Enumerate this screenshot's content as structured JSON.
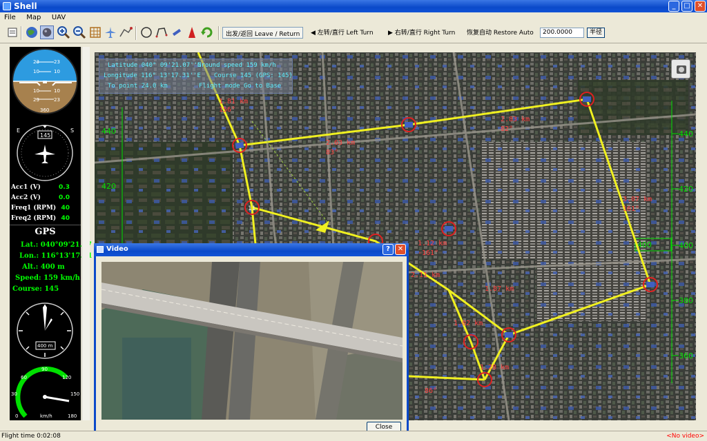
{
  "window": {
    "title": "Shell"
  },
  "menu": [
    "File",
    "Map",
    "UAV"
  ],
  "toolbar": {
    "leave_return": "出发/返回 Leave / Return",
    "left_turn": "◀ 左转/直行 Left Turn",
    "right_turn": "▶ 右转/直行 Right Turn",
    "restore_auto": "恢复自动 Restore Auto",
    "radius_value": "200.0000",
    "radius_button": "半径"
  },
  "instruments": {
    "attitude_ticks": [
      "23",
      "10",
      "10",
      "23"
    ],
    "attitude_heading": "360",
    "compass_heading": "145",
    "compass_letters": [
      "E",
      "S"
    ],
    "acc1_label": "Acc1 (V)",
    "acc1_value": "0.3",
    "acc2_label": "Acc2 (V)",
    "acc2_value": "0.0",
    "freq1_label": "Freq1 (RPM)",
    "freq1_value": "40",
    "freq2_label": "Freq2 (RPM)",
    "freq2_value": "40",
    "altimeter_label": "400 m",
    "speed_ticks": [
      "60",
      "90",
      "120",
      "150",
      "180",
      "30",
      "0"
    ],
    "speed_unit": "km/h"
  },
  "gps": {
    "title": "GPS",
    "lat": "Lat.: 040°09'21.07",
    "lon": "Lon.: 116°13'17.31",
    "alt": "Alt.: 400 m",
    "speed": "Speed: 159 km/h",
    "course": "Course: 145"
  },
  "flight_info": {
    "latitude": "Latitude 040° 09'21.07''N",
    "ground_speed": "Ground speed 159 km/h",
    "longitude": "Longitude 116° 13'17.31''E",
    "course": "Course 145 (GPS: 145)",
    "to_point": "To point 24.0 km",
    "flight_mode": "Flight mode Go to Base"
  },
  "route": {
    "segments": [
      {
        "dist": "1.81 km",
        "bearing": "156°"
      },
      {
        "dist": "2.63 km",
        "bearing": "83°"
      },
      {
        "dist": "2.83 km",
        "bearing": "82°"
      },
      {
        "dist": "3.07 km",
        "bearing": "161°"
      },
      {
        "dist": "1.12 km",
        "bearing": "-161°"
      },
      {
        "dist": "2.11 km",
        "bearing": ""
      },
      {
        "dist": "1.87 km",
        "bearing": ""
      },
      {
        "dist": "1.02 km",
        "bearing": ""
      },
      {
        "dist": "1.28 km",
        "bearing": ""
      },
      {
        "dist": "",
        "bearing": "86°"
      }
    ],
    "waypoint_id": "11"
  },
  "altitude_scale": {
    "left": [
      "440",
      "420"
    ],
    "right": [
      "440",
      "420",
      "400",
      "380",
      "360"
    ],
    "current": "400"
  },
  "video": {
    "title": "Video",
    "help_label": "?",
    "close_label": "Close"
  },
  "status": {
    "flight_time": "Flight time 0:02:08",
    "video_status": "<No video>"
  },
  "colors": {
    "route": "#f0f020",
    "waypoint": "#e02020",
    "scale": "#00e000"
  }
}
